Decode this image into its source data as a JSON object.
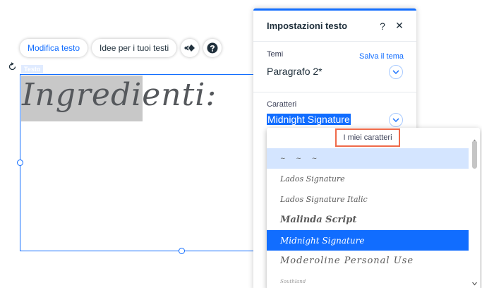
{
  "toolbar": {
    "edit_text_label": "Modifica testo",
    "text_ideas_label": "Idee per i tuoi testi"
  },
  "canvas": {
    "component_tag": "Testo",
    "text_content": "Ingredienti:"
  },
  "panel": {
    "title": "Impostazioni testo",
    "help_glyph": "?",
    "close_glyph": "✕",
    "themes": {
      "label": "Temi",
      "save_link": "Salva il tema",
      "value": "Paragrafo 2*"
    },
    "fonts": {
      "label": "Caratteri",
      "value": "Midnight Signature"
    }
  },
  "dropdown": {
    "category": "I miei caratteri",
    "items": [
      {
        "label": "~ ~ ~",
        "state": "hover"
      },
      {
        "label": "Lados Signature",
        "state": "normal"
      },
      {
        "label": "Lados Signature Italic",
        "state": "normal"
      },
      {
        "label": "Malinda Script",
        "state": "normal"
      },
      {
        "label": "Midnight Signature",
        "state": "active"
      },
      {
        "label": "Moderoline Personal Use",
        "state": "normal"
      },
      {
        "label": "Southland",
        "state": "normal"
      }
    ]
  },
  "colors": {
    "accent": "#116dff",
    "selection_outline": "#ef6a4a",
    "hover_row": "#d4e5ff"
  },
  "icons": [
    "rotate-icon",
    "animation-icon",
    "help-icon",
    "chevron-down-icon",
    "close-icon"
  ]
}
